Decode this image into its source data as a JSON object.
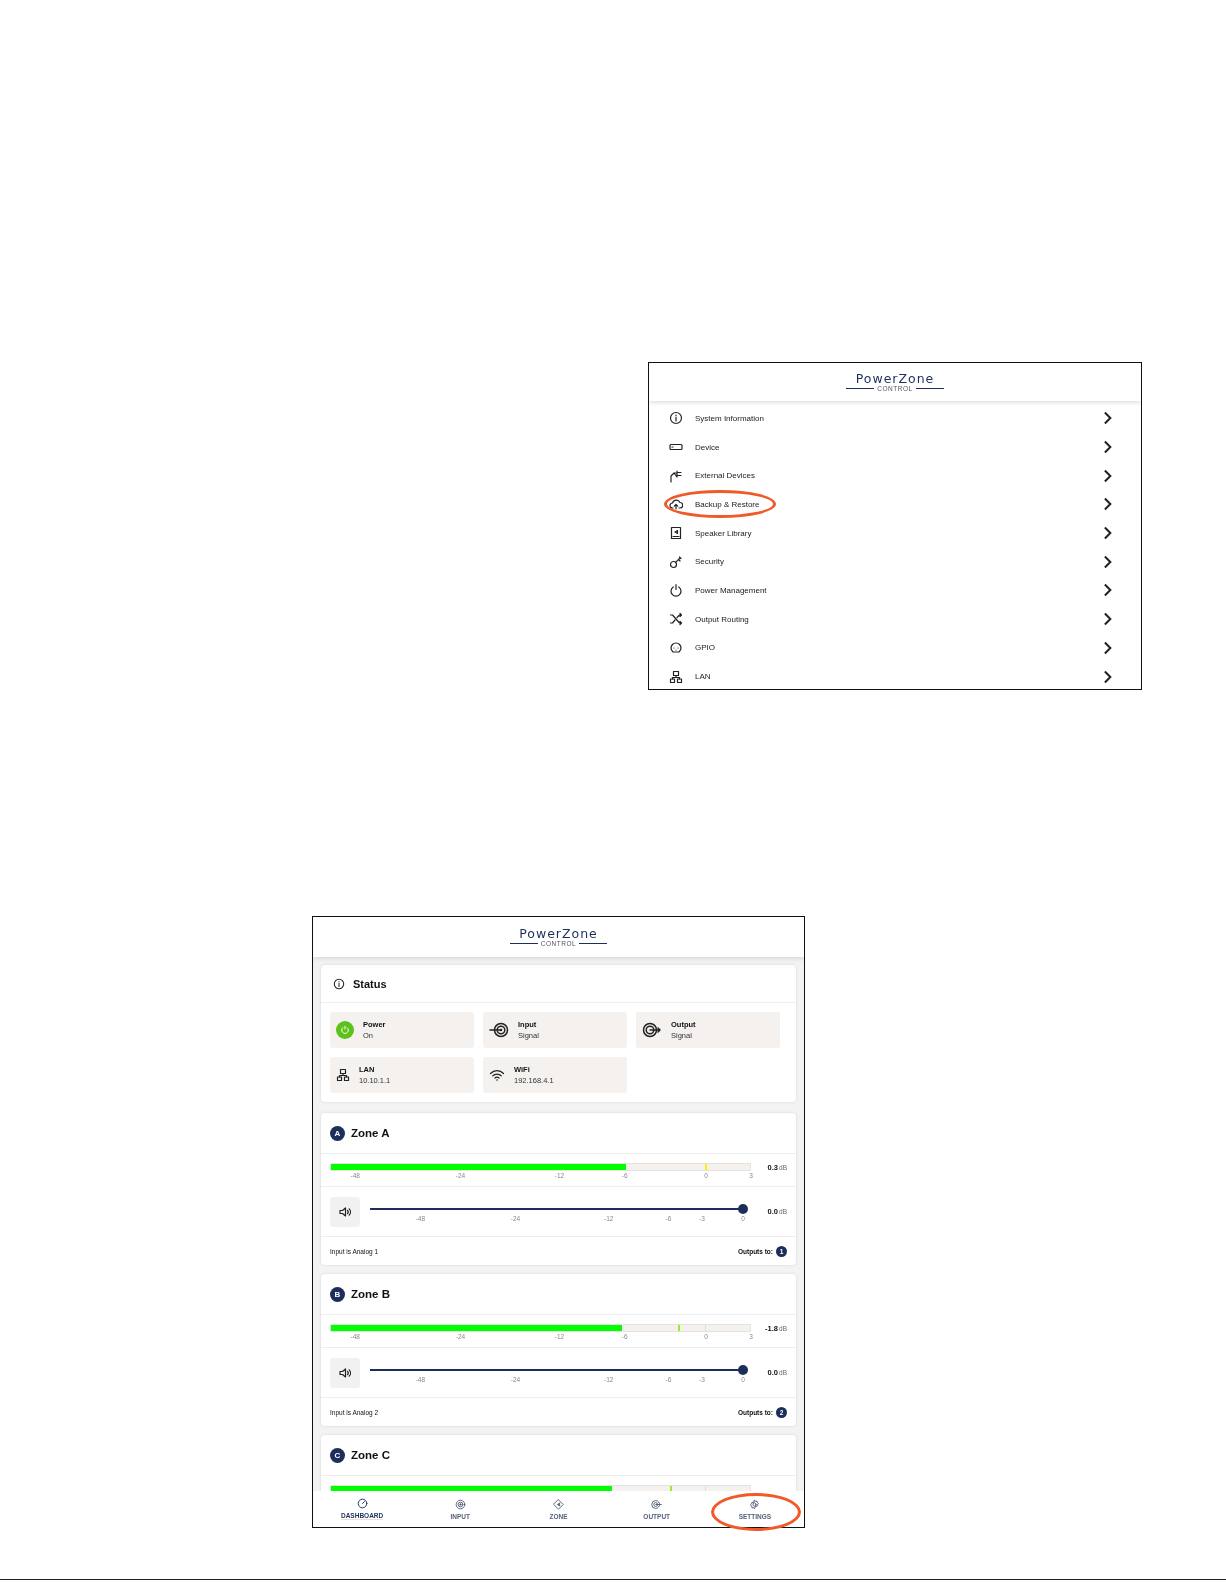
{
  "settings_screen": {
    "logo": {
      "name": "PowerZone",
      "tagline": "CONTROL"
    },
    "menu": [
      {
        "label": "System Information",
        "annotated": false
      },
      {
        "label": "Device",
        "annotated": false
      },
      {
        "label": "External Devices",
        "annotated": false
      },
      {
        "label": "Backup & Restore",
        "annotated": true
      },
      {
        "label": "Speaker Library",
        "annotated": false
      },
      {
        "label": "Security",
        "annotated": false
      },
      {
        "label": "Power Management",
        "annotated": false
      },
      {
        "label": "Output Routing",
        "annotated": false
      },
      {
        "label": "GPIO",
        "annotated": false
      },
      {
        "label": "LAN",
        "annotated": false
      }
    ]
  },
  "dashboard_screen": {
    "logo": {
      "name": "PowerZone",
      "tagline": "CONTROL"
    },
    "status": {
      "title": "Status",
      "tiles": [
        {
          "kind": "power",
          "label": "Power",
          "value": "On",
          "on": true
        },
        {
          "kind": "input",
          "label": "Input",
          "value": "Signal"
        },
        {
          "kind": "output",
          "label": "Output",
          "value": "Signal"
        },
        {
          "kind": "lan",
          "label": "LAN",
          "value": "10.10.1.1"
        },
        {
          "kind": "wifi",
          "label": "WiFi",
          "value": "192.168.4.1"
        }
      ]
    },
    "zones": [
      {
        "badge": "A",
        "title": "Zone A",
        "meter": {
          "level": 0.705,
          "peak": {
            "level": 0.893,
            "color": "#ffee00"
          },
          "reading": "0.3",
          "unit": "dB",
          "ticks": [
            "-48",
            "-24",
            "-12",
            "-6",
            "0",
            "3"
          ]
        },
        "volume": {
          "level": 1.0,
          "reading": "0.0",
          "unit": "dB",
          "ticks": [
            "-48",
            "-24",
            "-12",
            "-6",
            "-3",
            "0"
          ]
        },
        "input_text": "Input is Analog 1",
        "outputs_label": "Outputs to:",
        "outputs": [
          "1"
        ]
      },
      {
        "badge": "B",
        "title": "Zone B",
        "meter": {
          "level": 0.695,
          "peak": {
            "level": 0.827,
            "color": "#99ee22"
          },
          "reading": "-1.8",
          "unit": "dB",
          "ticks": [
            "-48",
            "-24",
            "-12",
            "-6",
            "0",
            "3"
          ]
        },
        "volume": {
          "level": 1.0,
          "reading": "0.0",
          "unit": "dB",
          "ticks": [
            "-48",
            "-24",
            "-12",
            "-6",
            "-3",
            "0"
          ]
        },
        "input_text": "Input is Analog 2",
        "outputs_label": "Outputs to:",
        "outputs": [
          "2"
        ]
      },
      {
        "badge": "C",
        "title": "Zone C",
        "meter": {
          "level": 0.67,
          "peak": {
            "level": 0.808,
            "color": "#99ee22"
          }
        }
      }
    ],
    "nav": [
      {
        "label": "DASHBOARD",
        "selected": true,
        "annotated": false
      },
      {
        "label": "INPUT",
        "selected": false,
        "annotated": false
      },
      {
        "label": "ZONE",
        "selected": false,
        "annotated": false
      },
      {
        "label": "OUTPUT",
        "selected": false,
        "annotated": false
      },
      {
        "label": "SETTINGS",
        "selected": false,
        "annotated": true
      }
    ]
  }
}
